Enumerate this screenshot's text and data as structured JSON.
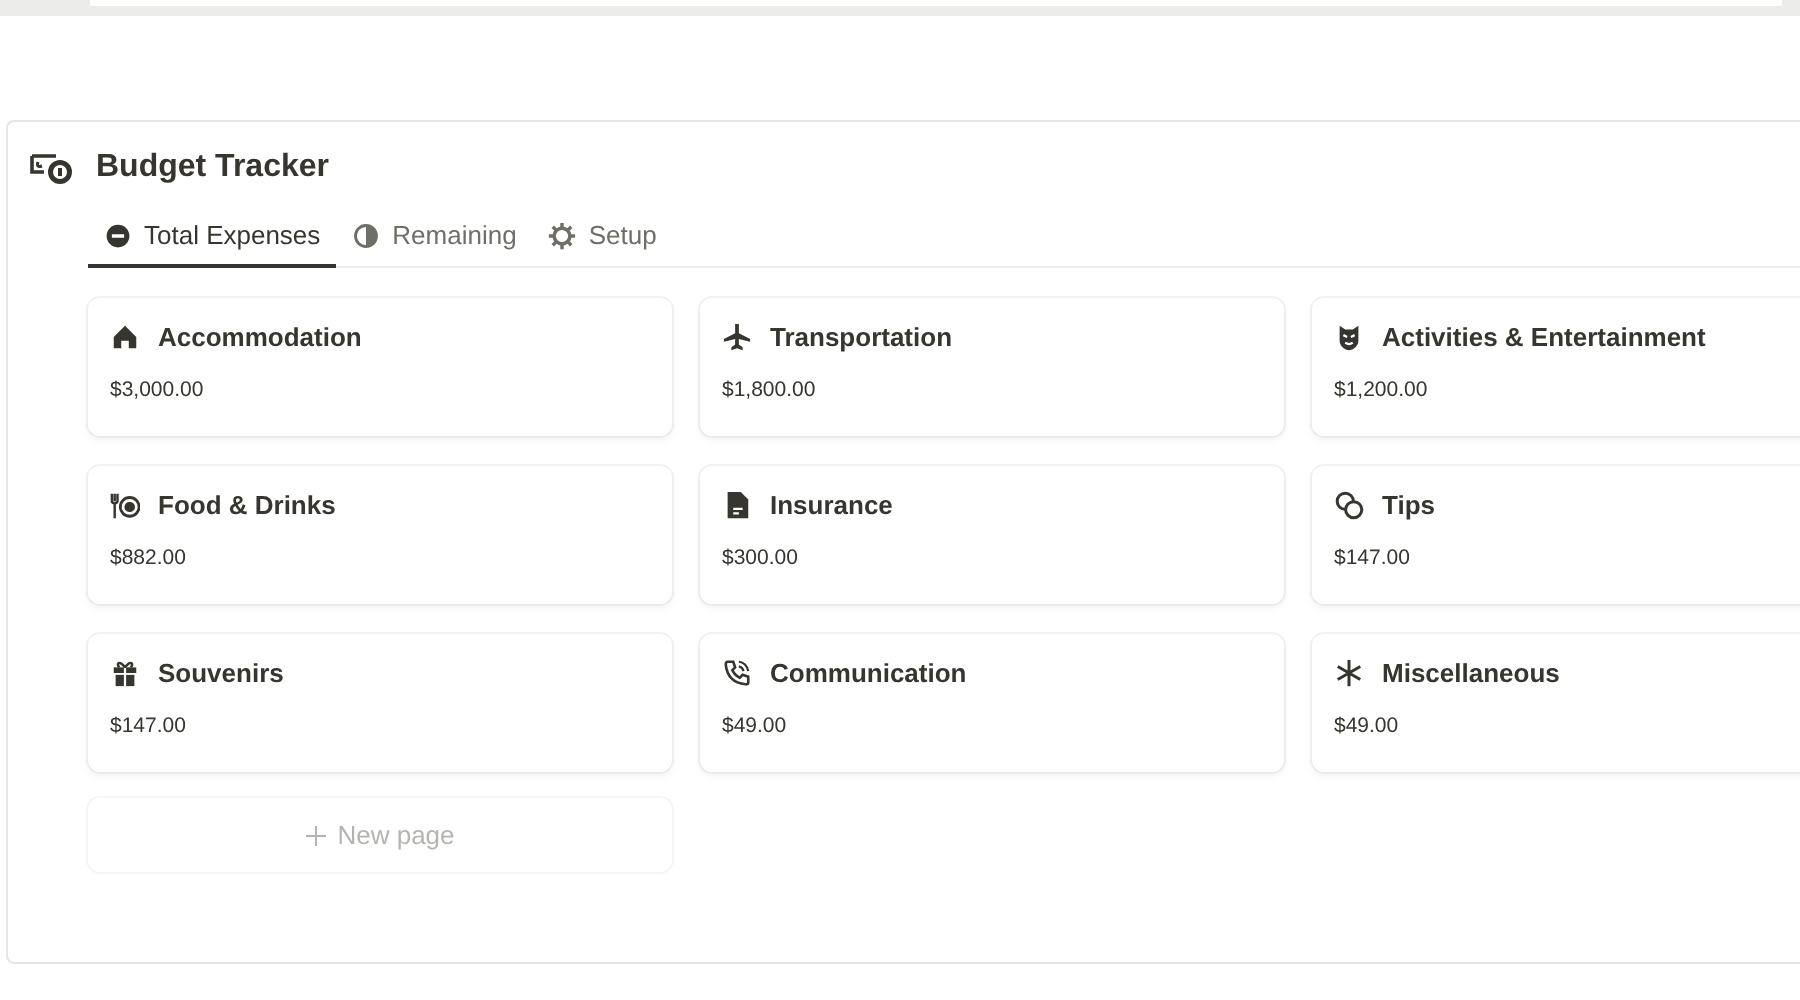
{
  "title": "Budget Tracker",
  "tabs": [
    {
      "label": "Total Expenses",
      "selected": true
    },
    {
      "label": "Remaining",
      "selected": false
    },
    {
      "label": "Setup",
      "selected": false
    }
  ],
  "cards": [
    {
      "name": "Accommodation",
      "amount": "$3,000.00"
    },
    {
      "name": "Transportation",
      "amount": "$1,800.00"
    },
    {
      "name": "Activities & Entertainment",
      "amount": "$1,200.00"
    },
    {
      "name": "Food & Drinks",
      "amount": "$882.00"
    },
    {
      "name": "Insurance",
      "amount": "$300.00"
    },
    {
      "name": "Tips",
      "amount": "$147.00"
    },
    {
      "name": "Souvenirs",
      "amount": "$147.00"
    },
    {
      "name": "Communication",
      "amount": "$49.00"
    },
    {
      "name": "Miscellaneous",
      "amount": "$49.00"
    }
  ],
  "new_page": {
    "label": "New page"
  }
}
